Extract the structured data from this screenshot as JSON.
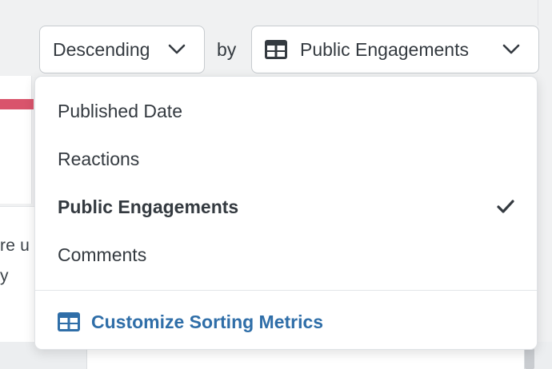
{
  "sort_order": {
    "label": "Descending"
  },
  "by_label": "by",
  "sort_metric": {
    "label": "Public Engagements"
  },
  "menu": {
    "items": [
      {
        "label": "Published Date",
        "selected": false
      },
      {
        "label": "Reactions",
        "selected": false
      },
      {
        "label": "Public Engagements",
        "selected": true
      },
      {
        "label": "Comments",
        "selected": false
      }
    ],
    "customize_label": "Customize Sorting Metrics"
  },
  "background": {
    "snippet_line1": "re u",
    "snippet_line2": "y"
  },
  "colors": {
    "accent": "#2f6ea8",
    "alert_bar": "#d9546c",
    "text": "#343a40"
  },
  "icons": {
    "table": "table-icon",
    "chevron": "chevron-down-icon",
    "check": "checkmark-icon"
  }
}
